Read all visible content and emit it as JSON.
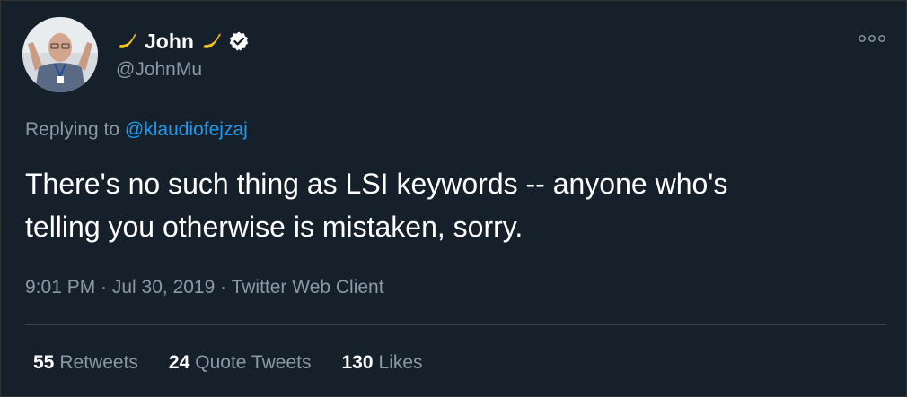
{
  "author": {
    "display_name": "John",
    "name_emoji_left": "banana-icon",
    "name_emoji_right": "banana-icon",
    "verified": true,
    "handle": "@JohnMu"
  },
  "reply": {
    "prefix": "Replying to",
    "mention": "@klaudiofejzaj"
  },
  "tweet": {
    "text_line1": "There's no such thing as LSI keywords -- anyone who's",
    "text_line2": "telling you otherwise is mistaken, sorry.",
    "timestamp": "9:01 PM · Jul 30, 2019 · Twitter Web Client"
  },
  "stats": {
    "retweets_count": "55",
    "retweets_label": "Retweets",
    "quotes_count": "24",
    "quotes_label": "Quote Tweets",
    "likes_count": "130",
    "likes_label": "Likes"
  },
  "colors": {
    "background": "#15202b",
    "text_primary": "#ffffff",
    "text_secondary": "#8b98a5",
    "link": "#1d9bf0",
    "divider": "#38444d"
  }
}
